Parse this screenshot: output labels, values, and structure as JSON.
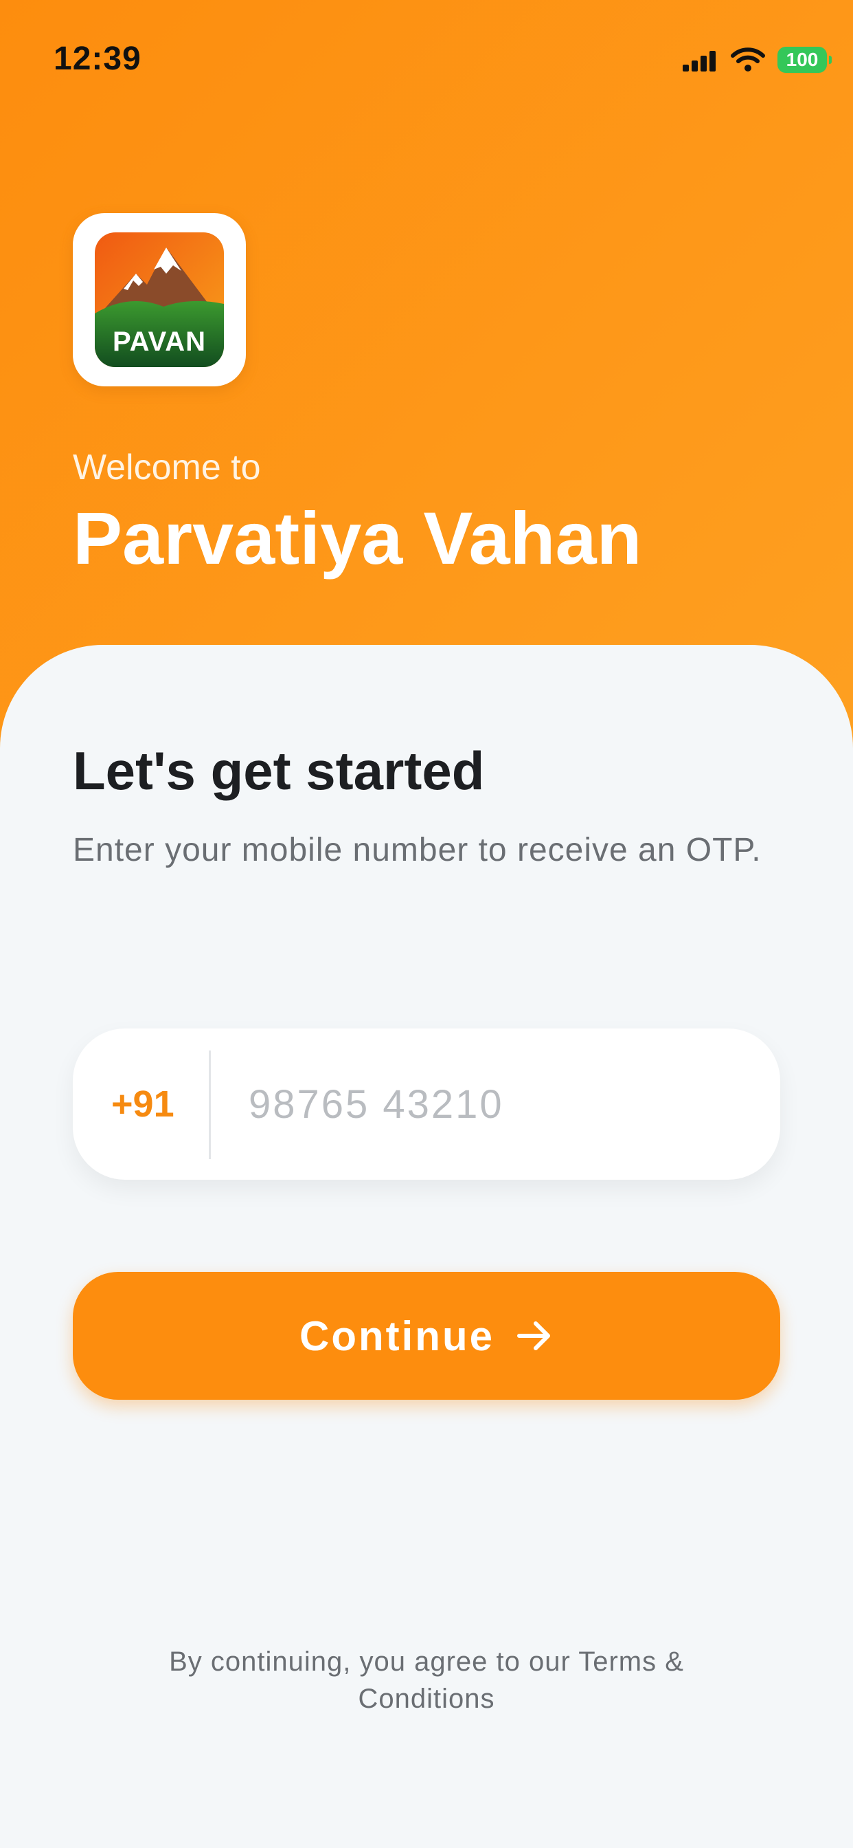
{
  "status_bar": {
    "time": "12:39",
    "battery": "100",
    "icons": [
      "cellular-signal-icon",
      "wifi-icon",
      "battery-icon"
    ]
  },
  "header": {
    "logo_text": "PAVAN",
    "welcome": "Welcome to",
    "title": "Parvatiya Vahan"
  },
  "login": {
    "heading": "Let's get started",
    "subheading": "Enter your mobile number to receive an OTP.",
    "country_code": "+91",
    "phone_placeholder": "98765 43210",
    "phone_value": "",
    "continue_label": "Continue",
    "continue_icon": "arrow-right-icon",
    "terms": "By continuing, you agree to our Terms & Conditions"
  },
  "colors": {
    "accent": "#fd8d0e",
    "header_gradient_end": "#fea021",
    "background": "#f4f7f9",
    "battery": "#34c759",
    "text_primary": "#1d1f22",
    "text_secondary": "#6a6e73"
  }
}
